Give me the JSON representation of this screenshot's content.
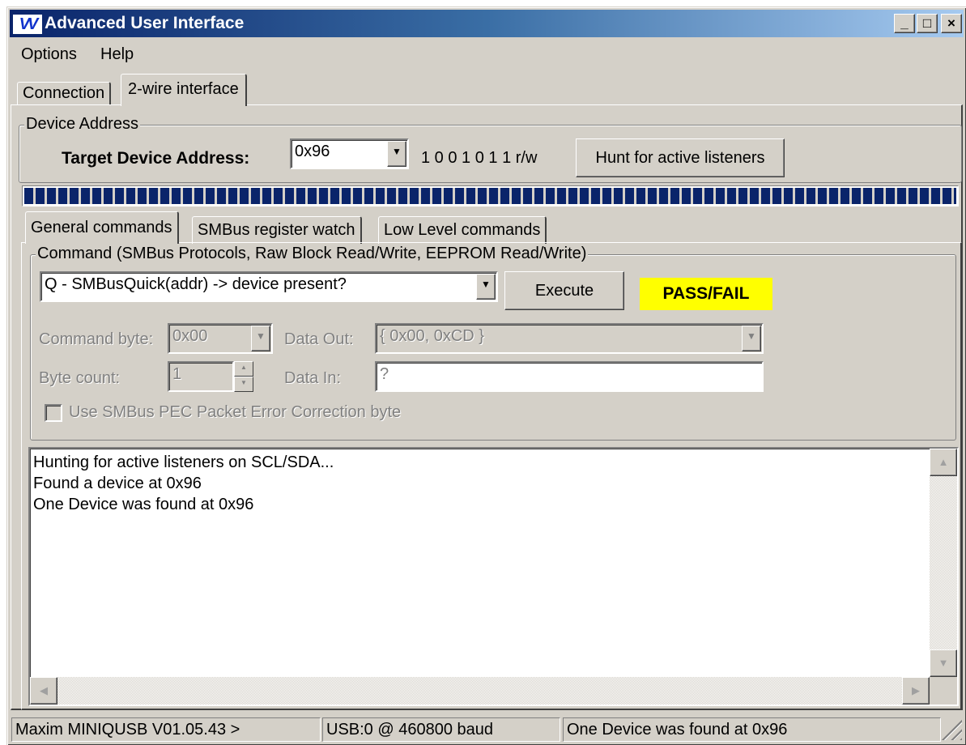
{
  "window": {
    "title": "Advanced User Interface",
    "icon_text": "VV",
    "controls": {
      "minimize": "_",
      "maximize": "□",
      "close": "×"
    }
  },
  "menu": [
    {
      "label": "Options"
    },
    {
      "label": "Help"
    }
  ],
  "main_tabs": [
    {
      "label": "Connection",
      "active": false
    },
    {
      "label": "2-wire interface",
      "active": true
    }
  ],
  "device_address": {
    "group_label": "Device Address",
    "target_label": "Target Device Address:",
    "address_value": "0x96",
    "binary": "1 0 0 1 0 1 1 r/w",
    "hunt_button": "Hunt for active listeners",
    "progress": 1.0
  },
  "sub_tabs": [
    {
      "label": "General commands",
      "active": true
    },
    {
      "label": "SMBus register watch",
      "active": false
    },
    {
      "label": "Low Level commands",
      "active": false
    }
  ],
  "command": {
    "group_label": "Command (SMBus Protocols, Raw Block Read/Write, EEPROM Read/Write)",
    "selected_command": "Q - SMBusQuick(addr) -> device present?",
    "execute_button": "Execute",
    "result": "PASS/FAIL",
    "result_color": "#ffff00",
    "command_byte_label": "Command byte:",
    "command_byte_value": "0x00",
    "data_out_label": "Data Out:",
    "data_out_value": "{ 0x00, 0xCD }",
    "byte_count_label": "Byte count:",
    "byte_count_value": "1",
    "data_in_label": "Data In:",
    "data_in_value": "?",
    "pec_label": "Use SMBus PEC Packet Error Correction byte",
    "pec_checked": false
  },
  "log": {
    "lines": [
      "Hunting for active listeners on SCL/SDA...",
      "Found a device at 0x96",
      "One Device was found at 0x96"
    ]
  },
  "status": {
    "firmware": "Maxim MINIQUSB V01.05.43 >",
    "connection": "USB:0 @ 460800 baud",
    "message": "One Device was found at 0x96"
  }
}
